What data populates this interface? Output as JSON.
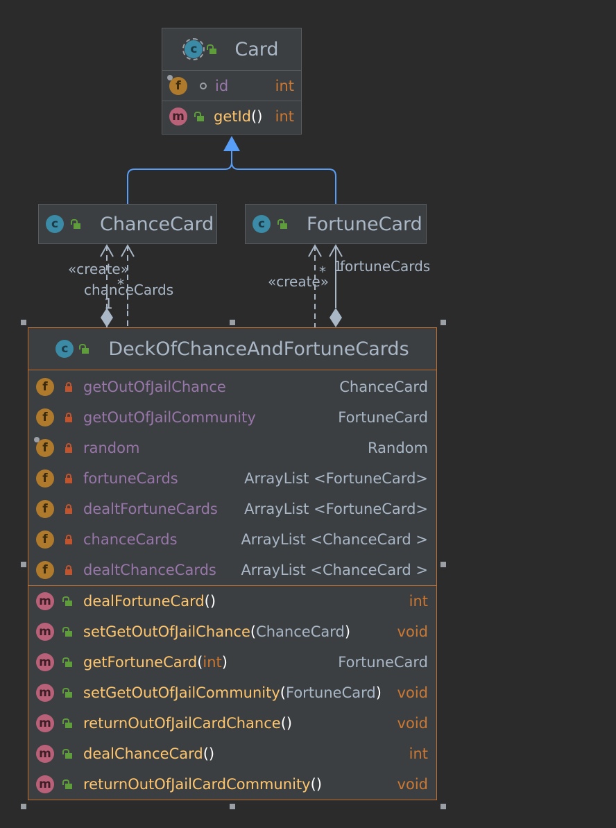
{
  "card": {
    "name": "Card",
    "badge": "c",
    "fields": [
      {
        "name": "id",
        "type": "int",
        "badge": "f"
      }
    ],
    "methods": [
      {
        "name": "getId",
        "paren_open": "(",
        "param": "",
        "paren_close": ")",
        "type": "int",
        "badge": "m"
      }
    ]
  },
  "chance_card": {
    "name": "ChanceCard",
    "badge": "c"
  },
  "fortune_card": {
    "name": "FortuneCard",
    "badge": "c"
  },
  "deck": {
    "name": "DeckOfChanceAndFortuneCards",
    "badge": "c",
    "fields": [
      {
        "name": "getOutOfJailChance",
        "type": "ChanceCard",
        "badge": "f"
      },
      {
        "name": "getOutOfJailCommunity",
        "type": "FortuneCard",
        "badge": "f"
      },
      {
        "name": "random",
        "type": "Random",
        "badge": "f"
      },
      {
        "name": "fortuneCards",
        "type": "ArrayList <FortuneCard>",
        "badge": "f"
      },
      {
        "name": "dealtFortuneCards",
        "type": "ArrayList <FortuneCard>",
        "badge": "f"
      },
      {
        "name": "chanceCards",
        "type": "ArrayList <ChanceCard >",
        "badge": "f"
      },
      {
        "name": "dealtChanceCards",
        "type": "ArrayList <ChanceCard >",
        "badge": "f"
      }
    ],
    "methods": [
      {
        "name": "dealFortuneCard",
        "paren_open": "(",
        "param": "",
        "paren_close": ")",
        "type": "int",
        "badge": "m"
      },
      {
        "name": "setGetOutOfJailChance",
        "paren_open": "(",
        "param": "ChanceCard",
        "paren_close": ")",
        "type": "void",
        "badge": "m"
      },
      {
        "name": "getFortuneCard",
        "paren_open": "(",
        "param": "int",
        "paren_close": ")",
        "type": "FortuneCard",
        "badge": "m"
      },
      {
        "name": "setGetOutOfJailCommunity",
        "paren_open": "(",
        "param": "FortuneCard",
        "paren_close": ")",
        "type": "void",
        "badge": "m"
      },
      {
        "name": "returnOutOfJailCardChance",
        "paren_open": "(",
        "param": "",
        "paren_close": ")",
        "type": "void",
        "badge": "m"
      },
      {
        "name": "dealChanceCard",
        "paren_open": "(",
        "param": "",
        "paren_close": ")",
        "type": "int",
        "badge": "m"
      },
      {
        "name": "returnOutOfJailCardCommunity",
        "paren_open": "(",
        "param": "",
        "paren_close": ")",
        "type": "void",
        "badge": "m"
      }
    ]
  },
  "labels": {
    "create_left": "«create»",
    "star_left": "*",
    "chance_cards": "chanceCards",
    "one_left": "1",
    "create_right": "«create»",
    "star_right": "*",
    "one_right": "1",
    "fortune_cards": "fortuneCards"
  },
  "colors": {
    "background": "#2b2b2b",
    "box": "#3c3f41",
    "selection": "#c56f2e",
    "inheritance": "#589df6",
    "field": "#9876aa",
    "method": "#ffc66d",
    "primitive": "#cc7832"
  }
}
